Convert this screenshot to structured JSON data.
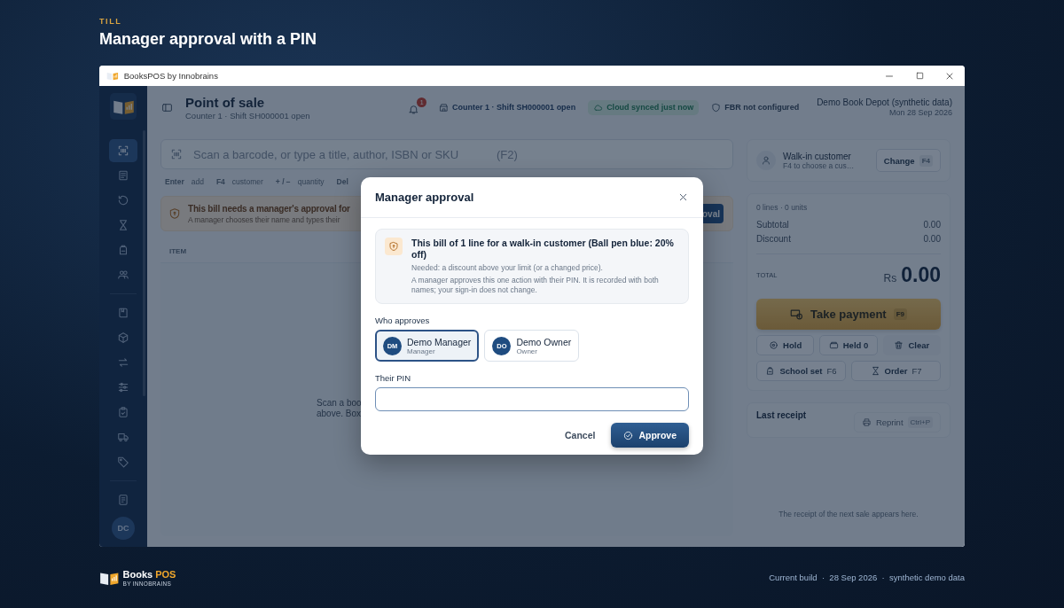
{
  "page_header": {
    "eyebrow": "TILL",
    "title": "Manager approval with a PIN"
  },
  "window": {
    "title": "BooksPOS by Innobrains"
  },
  "sidebar": {
    "items": [
      {
        "selected": true
      },
      {
        "selected": false
      },
      {
        "selected": false
      },
      {
        "selected": false
      },
      {
        "selected": false
      },
      {
        "selected": false
      },
      {
        "selected": false
      },
      {
        "selected": false
      },
      {
        "selected": false
      },
      {
        "selected": false
      },
      {
        "selected": false
      },
      {
        "selected": false
      },
      {
        "selected": false
      },
      {
        "selected": false
      }
    ],
    "avatar": "DC"
  },
  "topbar": {
    "title": "Point of sale",
    "subtitle": "Counter 1 · Shift SH000001 open",
    "notification_count": "1",
    "counter_status": "Counter 1 · Shift SH000001 open",
    "sync_status": "Cloud synced just now",
    "fbr_status": "FBR not configured",
    "store_name": "Demo Book Depot (synthetic data)",
    "date": "Mon 28 Sep 2026"
  },
  "search": {
    "placeholder": "Scan a barcode, or type a title, author, ISBN or SKU",
    "shortcut": "(F2)"
  },
  "shortcuts": [
    {
      "key": "Enter",
      "action": "add"
    },
    {
      "key": "F4",
      "action": "customer"
    },
    {
      "key": "+ / −",
      "action": "quantity"
    },
    {
      "key": "Del"
    }
  ],
  "approval_banner": {
    "title": "This bill needs a manager's approval for",
    "text": "A manager chooses their name and types their",
    "button": "oval"
  },
  "cart": {
    "columns": [
      "ITEM"
    ],
    "empty_lines": [
      "Scan a boo",
      "above. Box"
    ]
  },
  "customer": {
    "name": "Walk-in customer",
    "hint": "F4 to choose a cus…",
    "button": "Change",
    "button_key": "F4"
  },
  "totals": {
    "summary": "0 lines · 0 units",
    "rows": [
      {
        "label": "Subtotal",
        "value": "0.00"
      },
      {
        "label": "Discount",
        "value": "0.00"
      }
    ],
    "total_label": "TOTAL",
    "currency": "Rs",
    "total": "0.00"
  },
  "payment_button": {
    "label": "Take payment",
    "key": "F9"
  },
  "actions": [
    {
      "label": "Hold"
    },
    {
      "label": "Held 0"
    },
    {
      "label": "Clear"
    }
  ],
  "more_actions": [
    {
      "label": "School set",
      "key": "F6"
    },
    {
      "label": "Order",
      "key": "F7"
    }
  ],
  "last_receipt": {
    "title": "Last receipt",
    "button": "Reprint",
    "key": "Ctrl+P",
    "disabled": true,
    "empty_text": "The receipt of the next sale appears here."
  },
  "dialog": {
    "title": "Manager approval",
    "notice_title": "This bill of 1 line for a walk-in customer (Ball pen blue: 20% off)",
    "needed": "Needed: a discount above your limit (or a changed price).",
    "notice_text": "A manager approves this one action with their PIN. It is recorded with both names; your sign-in does not change.",
    "approver_label": "Who approves",
    "approvers": [
      {
        "initials": "DM",
        "name": "Demo Manager",
        "role": "Manager",
        "selected": true
      },
      {
        "initials": "DO",
        "name": "Demo Owner",
        "role": "Owner",
        "selected": false
      }
    ],
    "pin_label": "Their PIN",
    "cancel": "Cancel",
    "approve": "Approve"
  },
  "footer": {
    "brand": "Books",
    "brand_accent": "POS",
    "brand_sub": "BY INNOBRAINS",
    "build": "Current build  ·  28 Sep 2026  ·  synthetic demo data"
  }
}
